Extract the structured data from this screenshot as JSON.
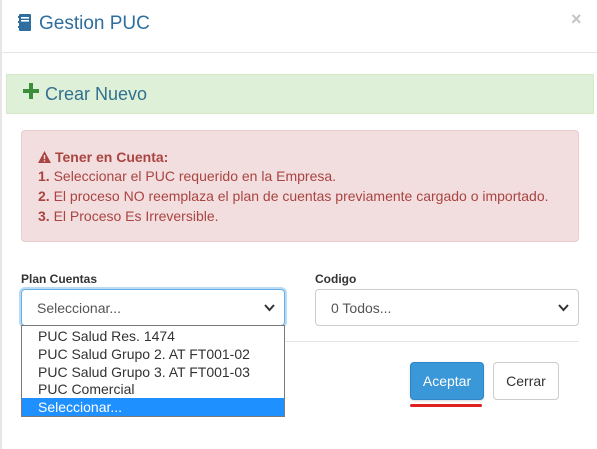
{
  "header": {
    "title": "Gestion PUC",
    "close_label": "×",
    "icon": "book-icon"
  },
  "create": {
    "label": "Crear Nuevo",
    "icon": "plus-icon"
  },
  "alert": {
    "icon": "warning-icon",
    "heading": "Tener en Cuenta:",
    "items": [
      {
        "num": "1.",
        "text": "Seleccionar el PUC requerido en la Empresa."
      },
      {
        "num": "2.",
        "text": "El proceso NO reemplaza el plan de cuentas previamente cargado o importado."
      },
      {
        "num": "3.",
        "text": "El Proceso Es Irreversible."
      }
    ]
  },
  "form": {
    "plan": {
      "label": "Plan Cuentas",
      "value": "Seleccionar...",
      "options": [
        "PUC Salud Res. 1474",
        "PUC Salud Grupo 2. AT FT001-02",
        "PUC Salud Grupo 3. AT FT001-03",
        "PUC Comercial",
        "Seleccionar..."
      ],
      "selected_index": 4
    },
    "codigo": {
      "label": "Codigo",
      "value": "0 Todos..."
    }
  },
  "buttons": {
    "accept": "Aceptar",
    "close": "Cerrar"
  },
  "colors": {
    "title": "#2f6f9f",
    "success_bg": "#dff0d8",
    "danger_bg": "#f2dede",
    "danger_text": "#a94442",
    "primary": "#3a97d8",
    "highlight": "#1e90ff",
    "annotation": "#e02020"
  }
}
